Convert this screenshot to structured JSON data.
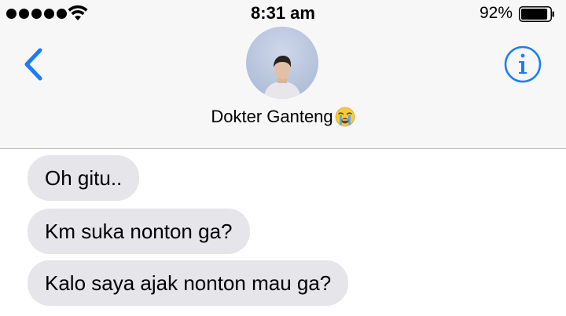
{
  "status_bar": {
    "time": "8:31 am",
    "battery_percent": "92%",
    "battery_level": 0.92,
    "signal_bars": 5
  },
  "header": {
    "back_icon": "chevron-left-icon",
    "info_icon": "info-icon",
    "contact_name": "Dokter Ganteng",
    "contact_emoji": "loudly-crying-face-icon",
    "accent_color": "#1b7cf6"
  },
  "messages": [
    {
      "text": "Oh gitu..",
      "direction": "received"
    },
    {
      "text": "Km suka nonton ga?",
      "direction": "received"
    },
    {
      "text": "Kalo saya ajak nonton mau ga?",
      "direction": "received"
    }
  ],
  "colors": {
    "received_bubble": "#e5e5ea",
    "header_bg": "#f7f7f7"
  }
}
